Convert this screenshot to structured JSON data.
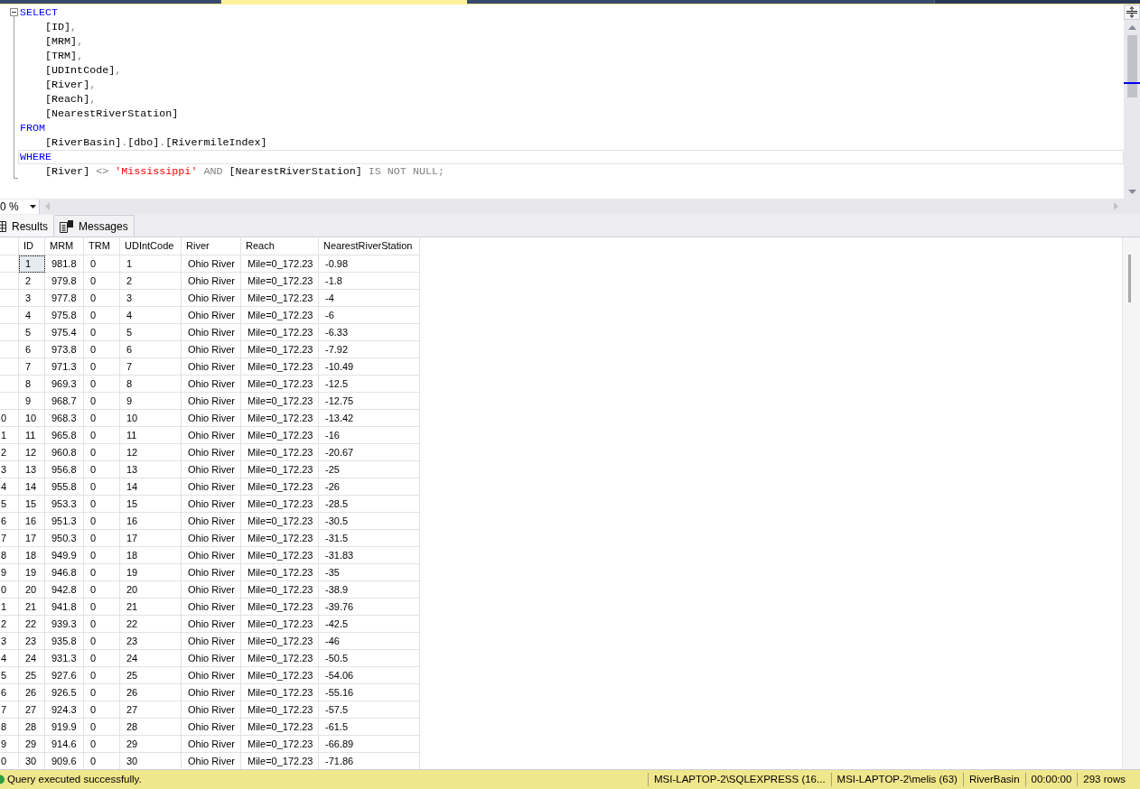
{
  "document_tabs": [
    {
      "selected": false
    },
    {
      "selected": true
    },
    {
      "selected": false
    }
  ],
  "editor": {
    "fold_expanded": true,
    "clauses": [
      {
        "current": false,
        "words": [
          [
            {
              "text": "SELECT",
              "kind": "keyword"
            }
          ]
        ],
        "children": [
          {
            "current": false,
            "words": [
              [
                {
                  "text": "[ID]",
                  "kind": "identifier"
                },
                {
                  "text": ",",
                  "kind": "punctuation"
                }
              ]
            ]
          },
          {
            "current": false,
            "words": [
              [
                {
                  "text": "[MRM]",
                  "kind": "identifier"
                },
                {
                  "text": ",",
                  "kind": "punctuation"
                }
              ]
            ]
          },
          {
            "current": false,
            "words": [
              [
                {
                  "text": "[TRM]",
                  "kind": "identifier"
                },
                {
                  "text": ",",
                  "kind": "punctuation"
                }
              ]
            ]
          },
          {
            "current": false,
            "words": [
              [
                {
                  "text": "[UDIntCode]",
                  "kind": "identifier"
                },
                {
                  "text": ",",
                  "kind": "punctuation"
                }
              ]
            ]
          },
          {
            "current": false,
            "words": [
              [
                {
                  "text": "[River]",
                  "kind": "identifier"
                },
                {
                  "text": ",",
                  "kind": "punctuation"
                }
              ]
            ]
          },
          {
            "current": false,
            "words": [
              [
                {
                  "text": "[Reach]",
                  "kind": "identifier"
                },
                {
                  "text": ",",
                  "kind": "punctuation"
                }
              ]
            ]
          },
          {
            "current": false,
            "words": [
              [
                {
                  "text": "[NearestRiverStation]",
                  "kind": "identifier"
                }
              ]
            ]
          }
        ]
      },
      {
        "current": false,
        "words": [
          [
            {
              "text": "FROM",
              "kind": "keyword"
            }
          ]
        ],
        "children": [
          {
            "current": false,
            "words": [
              [
                {
                  "text": "[RiverBasin]",
                  "kind": "identifier"
                },
                {
                  "text": ".",
                  "kind": "punctuation"
                },
                {
                  "text": "[dbo]",
                  "kind": "identifier"
                },
                {
                  "text": ".",
                  "kind": "punctuation"
                },
                {
                  "text": "[RivermileIndex]",
                  "kind": "identifier"
                }
              ]
            ]
          }
        ]
      },
      {
        "current": true,
        "words": [
          [
            {
              "text": "WHERE",
              "kind": "keyword"
            }
          ]
        ],
        "children": [
          {
            "current": false,
            "words": [
              [
                {
                  "text": "[River]",
                  "kind": "identifier"
                }
              ],
              [
                {
                  "text": "<>",
                  "kind": "operator"
                }
              ],
              [
                {
                  "text": "'Mississippi'",
                  "kind": "string"
                }
              ],
              [
                {
                  "text": "AND",
                  "kind": "operator"
                }
              ],
              [
                {
                  "text": "[NearestRiverStation]",
                  "kind": "identifier"
                }
              ],
              [
                {
                  "text": "IS",
                  "kind": "operator"
                }
              ],
              [
                {
                  "text": "NOT",
                  "kind": "operator"
                }
              ],
              [
                {
                  "text": "NULL",
                  "kind": "operator"
                },
                {
                  "text": ";",
                  "kind": "punctuation"
                }
              ]
            ]
          }
        ]
      }
    ]
  },
  "zoom": {
    "value": "0 %"
  },
  "result_tabs": [
    {
      "label": "Results",
      "selected": true,
      "kind": "grid"
    },
    {
      "label": "Messages",
      "selected": false,
      "kind": "messages"
    }
  ],
  "table": {
    "columns": [
      "ID",
      "MRM",
      "TRM",
      "UDIntCode",
      "River",
      "Reach",
      "NearestRiverStation"
    ],
    "rows": [
      {
        "focused": true,
        "cells": [
          "1",
          "981.8",
          "0",
          "1",
          "Ohio River",
          "Mile=0_172.23",
          "-0.98"
        ]
      },
      {
        "focused": false,
        "cells": [
          "2",
          "979.8",
          "0",
          "2",
          "Ohio River",
          "Mile=0_172.23",
          "-1.8"
        ]
      },
      {
        "focused": false,
        "cells": [
          "3",
          "977.8",
          "0",
          "3",
          "Ohio River",
          "Mile=0_172.23",
          "-4"
        ]
      },
      {
        "focused": false,
        "cells": [
          "4",
          "975.8",
          "0",
          "4",
          "Ohio River",
          "Mile=0_172.23",
          "-6"
        ]
      },
      {
        "focused": false,
        "cells": [
          "5",
          "975.4",
          "0",
          "5",
          "Ohio River",
          "Mile=0_172.23",
          "-6.33"
        ]
      },
      {
        "focused": false,
        "cells": [
          "6",
          "973.8",
          "0",
          "6",
          "Ohio River",
          "Mile=0_172.23",
          "-7.92"
        ]
      },
      {
        "focused": false,
        "cells": [
          "7",
          "971.3",
          "0",
          "7",
          "Ohio River",
          "Mile=0_172.23",
          "-10.49"
        ]
      },
      {
        "focused": false,
        "cells": [
          "8",
          "969.3",
          "0",
          "8",
          "Ohio River",
          "Mile=0_172.23",
          "-12.5"
        ]
      },
      {
        "focused": false,
        "cells": [
          "9",
          "968.7",
          "0",
          "9",
          "Ohio River",
          "Mile=0_172.23",
          "-12.75"
        ]
      },
      {
        "row_number": "0",
        "focused": false,
        "cells": [
          "10",
          "968.3",
          "0",
          "10",
          "Ohio River",
          "Mile=0_172.23",
          "-13.42"
        ]
      },
      {
        "row_number": "1",
        "focused": false,
        "cells": [
          "11",
          "965.8",
          "0",
          "11",
          "Ohio River",
          "Mile=0_172.23",
          "-16"
        ]
      },
      {
        "row_number": "2",
        "focused": false,
        "cells": [
          "12",
          "960.8",
          "0",
          "12",
          "Ohio River",
          "Mile=0_172.23",
          "-20.67"
        ]
      },
      {
        "row_number": "3",
        "focused": false,
        "cells": [
          "13",
          "956.8",
          "0",
          "13",
          "Ohio River",
          "Mile=0_172.23",
          "-25"
        ]
      },
      {
        "row_number": "4",
        "focused": false,
        "cells": [
          "14",
          "955.8",
          "0",
          "14",
          "Ohio River",
          "Mile=0_172.23",
          "-26"
        ]
      },
      {
        "row_number": "5",
        "focused": false,
        "cells": [
          "15",
          "953.3",
          "0",
          "15",
          "Ohio River",
          "Mile=0_172.23",
          "-28.5"
        ]
      },
      {
        "row_number": "6",
        "focused": false,
        "cells": [
          "16",
          "951.3",
          "0",
          "16",
          "Ohio River",
          "Mile=0_172.23",
          "-30.5"
        ]
      },
      {
        "row_number": "7",
        "focused": false,
        "cells": [
          "17",
          "950.3",
          "0",
          "17",
          "Ohio River",
          "Mile=0_172.23",
          "-31.5"
        ]
      },
      {
        "row_number": "8",
        "focused": false,
        "cells": [
          "18",
          "949.9",
          "0",
          "18",
          "Ohio River",
          "Mile=0_172.23",
          "-31.83"
        ]
      },
      {
        "row_number": "9",
        "focused": false,
        "cells": [
          "19",
          "946.8",
          "0",
          "19",
          "Ohio River",
          "Mile=0_172.23",
          "-35"
        ]
      },
      {
        "row_number": "0",
        "focused": false,
        "cells": [
          "20",
          "942.8",
          "0",
          "20",
          "Ohio River",
          "Mile=0_172.23",
          "-38.9"
        ]
      },
      {
        "row_number": "1",
        "focused": false,
        "cells": [
          "21",
          "941.8",
          "0",
          "21",
          "Ohio River",
          "Mile=0_172.23",
          "-39.76"
        ]
      },
      {
        "row_number": "2",
        "focused": false,
        "cells": [
          "22",
          "939.3",
          "0",
          "22",
          "Ohio River",
          "Mile=0_172.23",
          "-42.5"
        ]
      },
      {
        "row_number": "3",
        "focused": false,
        "cells": [
          "23",
          "935.8",
          "0",
          "23",
          "Ohio River",
          "Mile=0_172.23",
          "-46"
        ]
      },
      {
        "row_number": "4",
        "focused": false,
        "cells": [
          "24",
          "931.3",
          "0",
          "24",
          "Ohio River",
          "Mile=0_172.23",
          "-50.5"
        ]
      },
      {
        "row_number": "5",
        "focused": false,
        "cells": [
          "25",
          "927.6",
          "0",
          "25",
          "Ohio River",
          "Mile=0_172.23",
          "-54.06"
        ]
      },
      {
        "row_number": "6",
        "focused": false,
        "cells": [
          "26",
          "926.5",
          "0",
          "26",
          "Ohio River",
          "Mile=0_172.23",
          "-55.16"
        ]
      },
      {
        "row_number": "7",
        "focused": false,
        "cells": [
          "27",
          "924.3",
          "0",
          "27",
          "Ohio River",
          "Mile=0_172.23",
          "-57.5"
        ]
      },
      {
        "row_number": "8",
        "focused": false,
        "cells": [
          "28",
          "919.9",
          "0",
          "28",
          "Ohio River",
          "Mile=0_172.23",
          "-61.5"
        ]
      },
      {
        "row_number": "9",
        "focused": false,
        "cells": [
          "29",
          "914.6",
          "0",
          "29",
          "Ohio River",
          "Mile=0_172.23",
          "-66.89"
        ]
      },
      {
        "row_number": "0",
        "focused": false,
        "cells": [
          "30",
          "909.6",
          "0",
          "30",
          "Ohio River",
          "Mile=0_172.23",
          "-71.86"
        ]
      }
    ]
  },
  "status_bar": {
    "message": "Query executed successfully.",
    "segments": [
      "MSI-LAPTOP-2\\SQLEXPRESS (16...",
      "MSI-LAPTOP-2\\melis (63)",
      "RiverBasin",
      "00:00:00",
      "293 rows"
    ]
  }
}
